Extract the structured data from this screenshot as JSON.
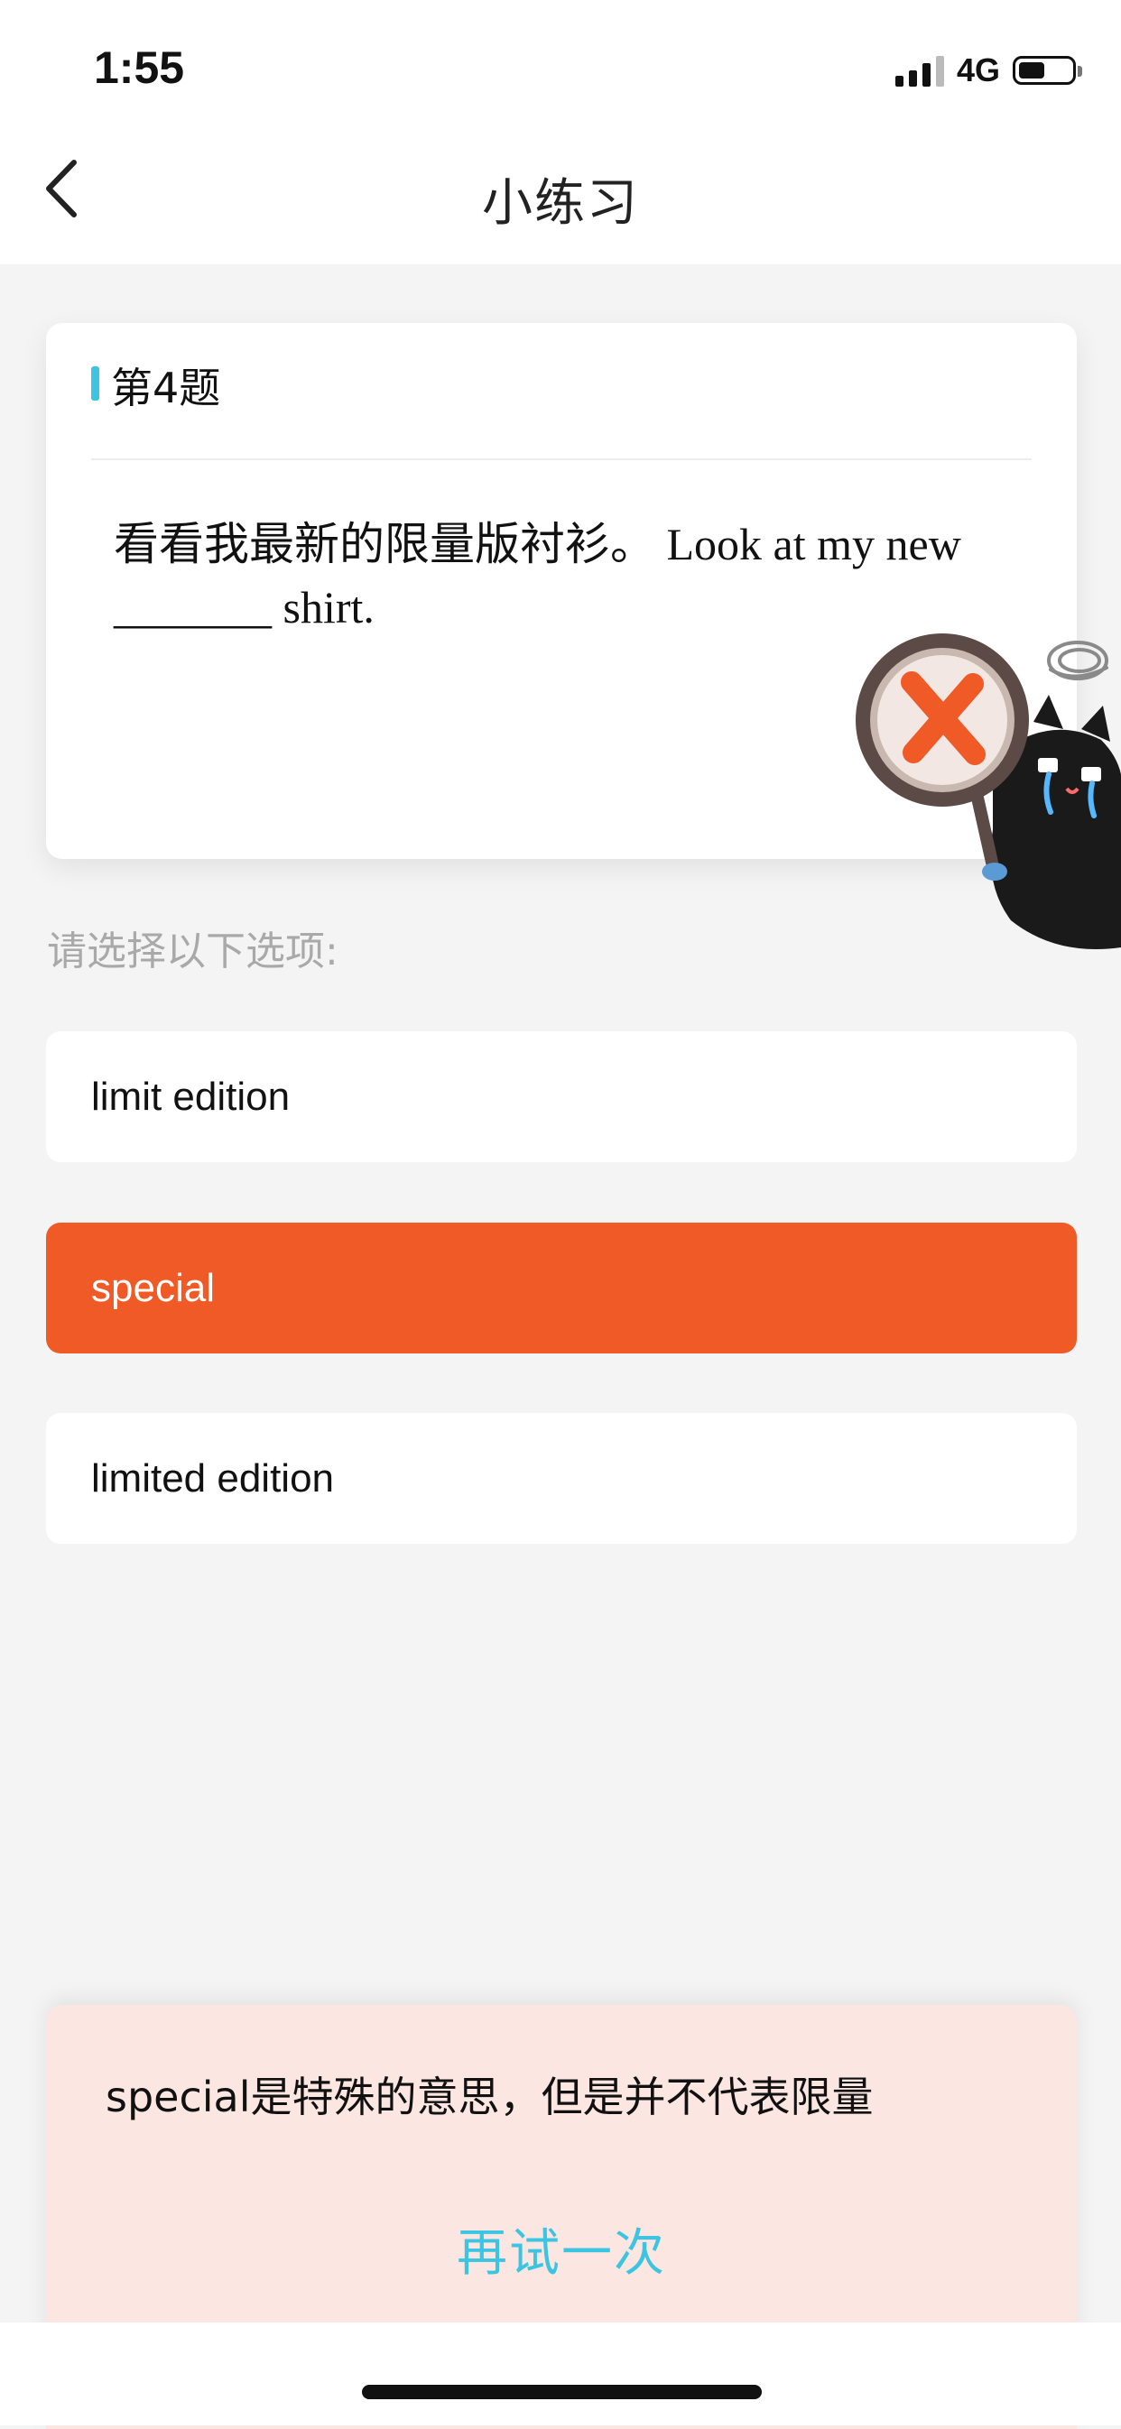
{
  "status_bar": {
    "time": "1:55",
    "network": "4G",
    "signal_bars": 4,
    "battery_level": 0.45
  },
  "nav": {
    "back_icon": "chevron-left-icon",
    "title": "小练习"
  },
  "question": {
    "number_label": "第4题",
    "text": "看看我最新的限量版衬衫。 Look at my new _______ shirt."
  },
  "sticker": {
    "icon": "wrong-answer-cat-sticker",
    "accent_color": "#ef5a27"
  },
  "prompt": "请选择以下选项:",
  "options": [
    {
      "label": "limit edition",
      "state": "default"
    },
    {
      "label": "special",
      "state": "wrong"
    },
    {
      "label": "limited edition",
      "state": "default"
    }
  ],
  "feedback": {
    "explanation": "special是特殊的意思，但是并不代表限量",
    "retry_label": "再试一次"
  },
  "colors": {
    "accent": "#3cc4e3",
    "wrong": "#ef5a27",
    "feedback_bg": "#fbe6e1",
    "page_bg": "#f4f4f4"
  }
}
